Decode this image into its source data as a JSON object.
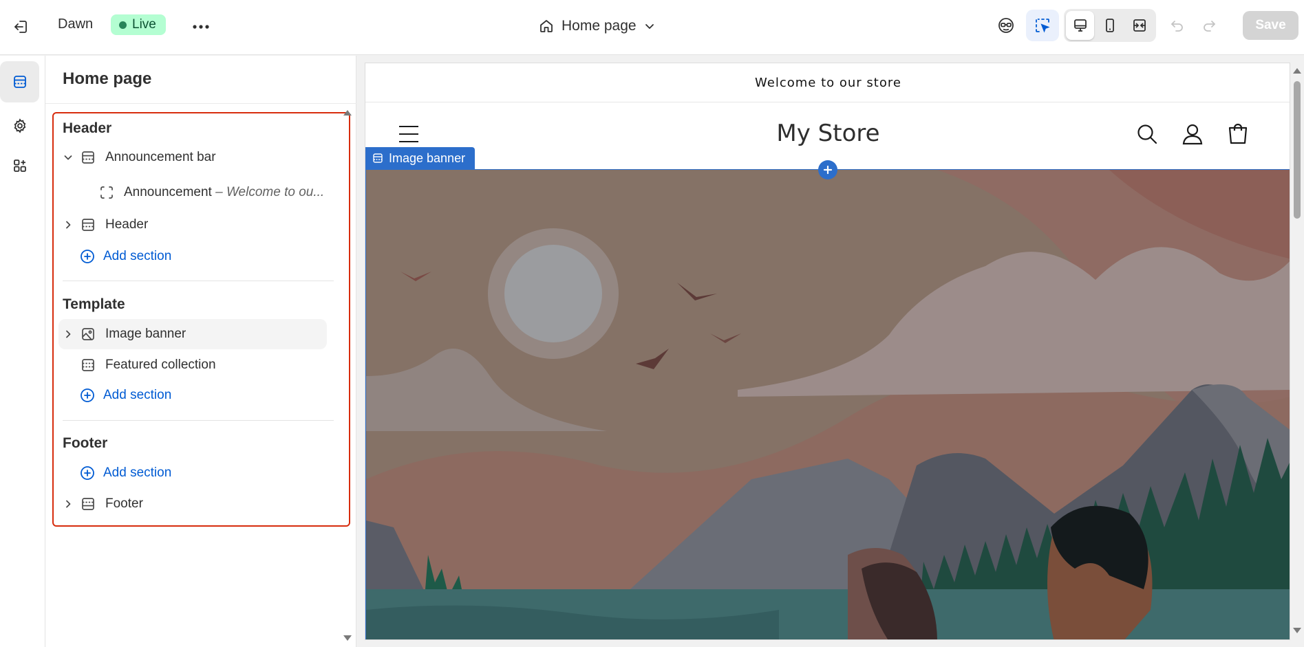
{
  "topbar": {
    "theme_name": "Dawn",
    "status_label": "Live",
    "page_selector": "Home page",
    "save_label": "Save"
  },
  "sidebar": {
    "title": "Home page",
    "header_group": {
      "title": "Header",
      "announcement_bar": "Announcement bar",
      "announcement_block": "Announcement",
      "announcement_preview": "– Welcome to ou...",
      "header": "Header",
      "add_section": "Add section"
    },
    "template_group": {
      "title": "Template",
      "image_banner": "Image banner",
      "featured_collection": "Featured collection",
      "add_section": "Add section"
    },
    "footer_group": {
      "title": "Footer",
      "add_section": "Add section",
      "footer": "Footer"
    }
  },
  "preview": {
    "announcement_text": "Welcome to our store",
    "store_name": "My Store",
    "selected_section_tag": "Image banner"
  },
  "colors": {
    "accent_blue": "#005bd3",
    "selection_blue": "#2c6ecb",
    "highlight_red": "#d72c0d",
    "live_badge_bg": "#b4fed2"
  }
}
